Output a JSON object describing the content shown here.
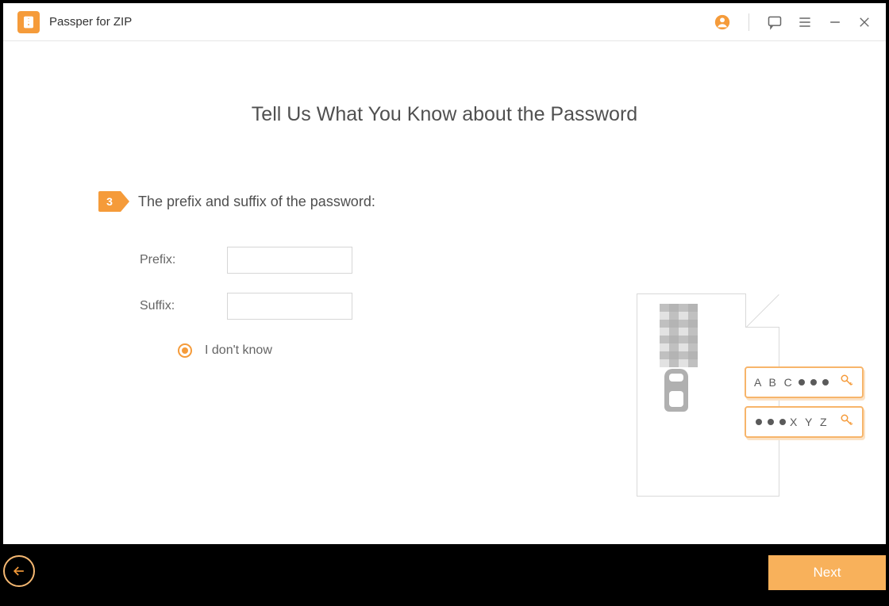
{
  "app": {
    "title": "Passper for ZIP"
  },
  "page": {
    "title": "Tell Us What You Know about the Password"
  },
  "step": {
    "number": "3",
    "text": "The prefix and suffix of the password:"
  },
  "form": {
    "prefix_label": "Prefix:",
    "prefix_value": "",
    "suffix_label": "Suffix:",
    "suffix_value": "",
    "idk_label": "I don't know",
    "idk_selected": true
  },
  "illustration": {
    "tag1_letters": "A B C",
    "tag2_letters": "X Y Z"
  },
  "footer": {
    "next_label": "Next"
  },
  "colors": {
    "accent": "#f59b3a"
  }
}
